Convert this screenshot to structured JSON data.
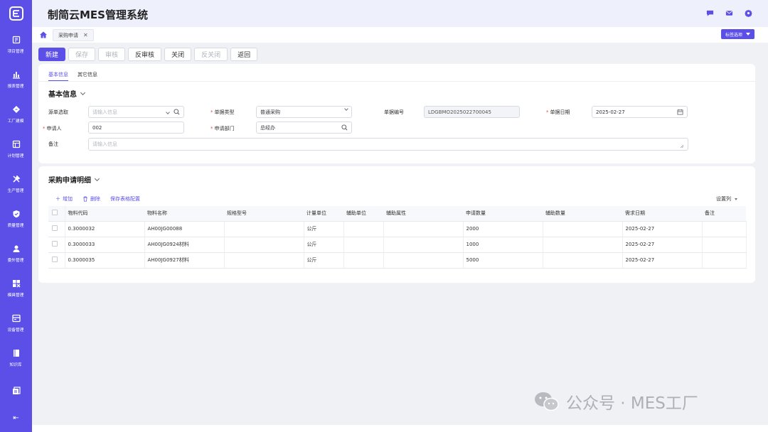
{
  "app": {
    "title": "制简云MES管理系统"
  },
  "sidebar": {
    "items": [
      {
        "label": "项目管理",
        "icon": "project-icon"
      },
      {
        "label": "报表管理",
        "icon": "bar-chart-icon"
      },
      {
        "label": "工厂建模",
        "icon": "factory-icon"
      },
      {
        "label": "计划管理",
        "icon": "plan-icon"
      },
      {
        "label": "生产管理",
        "icon": "tools-icon"
      },
      {
        "label": "质量管理",
        "icon": "shield-icon"
      },
      {
        "label": "委外管理",
        "icon": "outsource-icon"
      },
      {
        "label": "模具管理",
        "icon": "mold-icon"
      },
      {
        "label": "设备管理",
        "icon": "device-icon"
      },
      {
        "label": "知识库",
        "icon": "book-icon"
      },
      {
        "label": "",
        "icon": "document-icon"
      }
    ],
    "collapse_glyph": "⇤"
  },
  "tabs": [
    {
      "label": "采购申请"
    }
  ],
  "tag_options_label": "标签选项",
  "toolbar": {
    "new": "新建",
    "save": "保存",
    "audit": "审核",
    "unaudit": "反审核",
    "close": "关闭",
    "unclose": "反关闭",
    "back": "返回"
  },
  "subtabs": {
    "basic": "基本信息",
    "other": "其它信息"
  },
  "basic_section": {
    "title": "基本信息",
    "source_label": "源单选取",
    "source_placeholder": "请输入信息",
    "doctype_label": "单据类型",
    "doctype_value": "普通采购",
    "docno_label": "单据编号",
    "docno_value": "LDGBMO2025022700045",
    "docdate_label": "单据日期",
    "docdate_value": "2025-02-27",
    "applicant_label": "申请人",
    "applicant_value": "002",
    "dept_label": "申请部门",
    "dept_value": "总经办",
    "remark_label": "备注",
    "remark_placeholder": "请输入信息"
  },
  "detail_section": {
    "title": "采购申请明细",
    "add": "增加",
    "delete": "删除",
    "save_config": "保存表格配置",
    "column_settings": "设置列",
    "columns": [
      "物料代码",
      "物料名称",
      "规格型号",
      "计量单位",
      "辅助单位",
      "辅助属性",
      "申请数量",
      "辅助数量",
      "需求日期",
      "备注"
    ],
    "rows": [
      {
        "code": "0.3000032",
        "name": "AH00JG00088",
        "spec": "",
        "unit": "公斤",
        "aux_unit": "",
        "aux_attr": "",
        "qty": "2000",
        "aux_qty": "",
        "date": "2025-02-27",
        "remark": ""
      },
      {
        "code": "0.3000033",
        "name": "AH00JG0924材料",
        "spec": "",
        "unit": "公斤",
        "aux_unit": "",
        "aux_attr": "",
        "qty": "1000",
        "aux_qty": "",
        "date": "2025-02-27",
        "remark": ""
      },
      {
        "code": "0.3000035",
        "name": "AH00JG0927材料",
        "spec": "",
        "unit": "公斤",
        "aux_unit": "",
        "aux_attr": "",
        "qty": "5000",
        "aux_qty": "",
        "date": "2025-02-27",
        "remark": ""
      }
    ]
  },
  "watermark": {
    "text": "公众号 · MES工厂"
  },
  "colors": {
    "primary": "#5b4fe8",
    "required": "#e24c4c"
  }
}
